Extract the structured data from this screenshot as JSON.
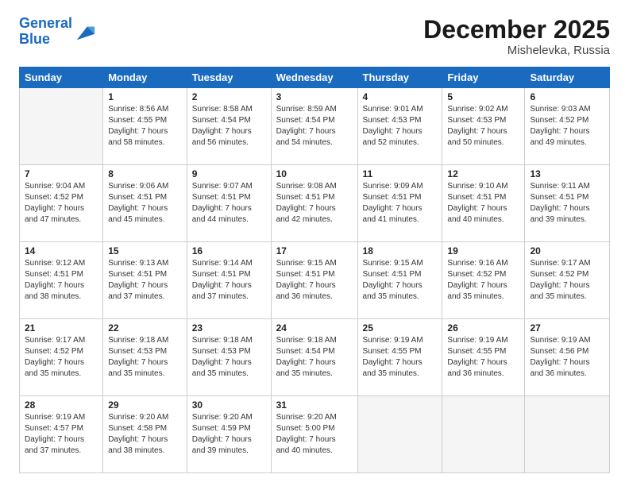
{
  "header": {
    "logo_line1": "General",
    "logo_line2": "Blue",
    "month": "December 2025",
    "location": "Mishelevka, Russia"
  },
  "weekdays": [
    "Sunday",
    "Monday",
    "Tuesday",
    "Wednesday",
    "Thursday",
    "Friday",
    "Saturday"
  ],
  "weeks": [
    [
      {
        "day": "",
        "info": ""
      },
      {
        "day": "1",
        "info": "Sunrise: 8:56 AM\nSunset: 4:55 PM\nDaylight: 7 hours\nand 58 minutes."
      },
      {
        "day": "2",
        "info": "Sunrise: 8:58 AM\nSunset: 4:54 PM\nDaylight: 7 hours\nand 56 minutes."
      },
      {
        "day": "3",
        "info": "Sunrise: 8:59 AM\nSunset: 4:54 PM\nDaylight: 7 hours\nand 54 minutes."
      },
      {
        "day": "4",
        "info": "Sunrise: 9:01 AM\nSunset: 4:53 PM\nDaylight: 7 hours\nand 52 minutes."
      },
      {
        "day": "5",
        "info": "Sunrise: 9:02 AM\nSunset: 4:53 PM\nDaylight: 7 hours\nand 50 minutes."
      },
      {
        "day": "6",
        "info": "Sunrise: 9:03 AM\nSunset: 4:52 PM\nDaylight: 7 hours\nand 49 minutes."
      }
    ],
    [
      {
        "day": "7",
        "info": "Sunrise: 9:04 AM\nSunset: 4:52 PM\nDaylight: 7 hours\nand 47 minutes."
      },
      {
        "day": "8",
        "info": "Sunrise: 9:06 AM\nSunset: 4:51 PM\nDaylight: 7 hours\nand 45 minutes."
      },
      {
        "day": "9",
        "info": "Sunrise: 9:07 AM\nSunset: 4:51 PM\nDaylight: 7 hours\nand 44 minutes."
      },
      {
        "day": "10",
        "info": "Sunrise: 9:08 AM\nSunset: 4:51 PM\nDaylight: 7 hours\nand 42 minutes."
      },
      {
        "day": "11",
        "info": "Sunrise: 9:09 AM\nSunset: 4:51 PM\nDaylight: 7 hours\nand 41 minutes."
      },
      {
        "day": "12",
        "info": "Sunrise: 9:10 AM\nSunset: 4:51 PM\nDaylight: 7 hours\nand 40 minutes."
      },
      {
        "day": "13",
        "info": "Sunrise: 9:11 AM\nSunset: 4:51 PM\nDaylight: 7 hours\nand 39 minutes."
      }
    ],
    [
      {
        "day": "14",
        "info": "Sunrise: 9:12 AM\nSunset: 4:51 PM\nDaylight: 7 hours\nand 38 minutes."
      },
      {
        "day": "15",
        "info": "Sunrise: 9:13 AM\nSunset: 4:51 PM\nDaylight: 7 hours\nand 37 minutes."
      },
      {
        "day": "16",
        "info": "Sunrise: 9:14 AM\nSunset: 4:51 PM\nDaylight: 7 hours\nand 37 minutes."
      },
      {
        "day": "17",
        "info": "Sunrise: 9:15 AM\nSunset: 4:51 PM\nDaylight: 7 hours\nand 36 minutes."
      },
      {
        "day": "18",
        "info": "Sunrise: 9:15 AM\nSunset: 4:51 PM\nDaylight: 7 hours\nand 35 minutes."
      },
      {
        "day": "19",
        "info": "Sunrise: 9:16 AM\nSunset: 4:52 PM\nDaylight: 7 hours\nand 35 minutes."
      },
      {
        "day": "20",
        "info": "Sunrise: 9:17 AM\nSunset: 4:52 PM\nDaylight: 7 hours\nand 35 minutes."
      }
    ],
    [
      {
        "day": "21",
        "info": "Sunrise: 9:17 AM\nSunset: 4:52 PM\nDaylight: 7 hours\nand 35 minutes."
      },
      {
        "day": "22",
        "info": "Sunrise: 9:18 AM\nSunset: 4:53 PM\nDaylight: 7 hours\nand 35 minutes."
      },
      {
        "day": "23",
        "info": "Sunrise: 9:18 AM\nSunset: 4:53 PM\nDaylight: 7 hours\nand 35 minutes."
      },
      {
        "day": "24",
        "info": "Sunrise: 9:18 AM\nSunset: 4:54 PM\nDaylight: 7 hours\nand 35 minutes."
      },
      {
        "day": "25",
        "info": "Sunrise: 9:19 AM\nSunset: 4:55 PM\nDaylight: 7 hours\nand 35 minutes."
      },
      {
        "day": "26",
        "info": "Sunrise: 9:19 AM\nSunset: 4:55 PM\nDaylight: 7 hours\nand 36 minutes."
      },
      {
        "day": "27",
        "info": "Sunrise: 9:19 AM\nSunset: 4:56 PM\nDaylight: 7 hours\nand 36 minutes."
      }
    ],
    [
      {
        "day": "28",
        "info": "Sunrise: 9:19 AM\nSunset: 4:57 PM\nDaylight: 7 hours\nand 37 minutes."
      },
      {
        "day": "29",
        "info": "Sunrise: 9:20 AM\nSunset: 4:58 PM\nDaylight: 7 hours\nand 38 minutes."
      },
      {
        "day": "30",
        "info": "Sunrise: 9:20 AM\nSunset: 4:59 PM\nDaylight: 7 hours\nand 39 minutes."
      },
      {
        "day": "31",
        "info": "Sunrise: 9:20 AM\nSunset: 5:00 PM\nDaylight: 7 hours\nand 40 minutes."
      },
      {
        "day": "",
        "info": ""
      },
      {
        "day": "",
        "info": ""
      },
      {
        "day": "",
        "info": ""
      }
    ]
  ]
}
